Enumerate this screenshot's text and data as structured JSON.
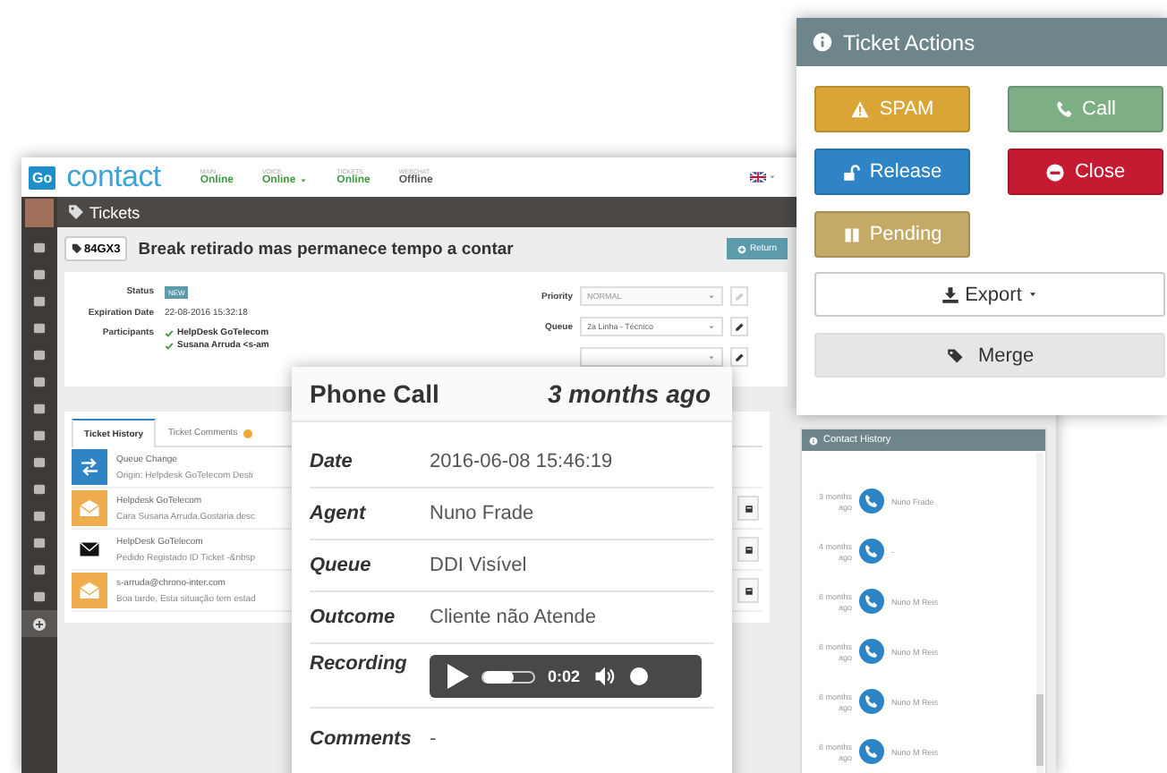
{
  "app": {
    "logo": "Go",
    "brand": "contact",
    "statuses": [
      {
        "label": "MAIN",
        "value": "Online",
        "online": true,
        "dropdown": false
      },
      {
        "label": "VOICE",
        "value": "Online",
        "online": true,
        "dropdown": true
      },
      {
        "label": "TICKETS",
        "value": "Online",
        "online": true,
        "dropdown": false
      },
      {
        "label": "WEBCHAT",
        "value": "Offline",
        "online": false,
        "dropdown": false
      }
    ],
    "section_title": "Tickets",
    "sidebar": {
      "items": [
        {
          "selected": false
        },
        {
          "selected": false
        },
        {
          "selected": false
        },
        {
          "selected": false
        },
        {
          "selected": false
        },
        {
          "selected": false
        },
        {
          "selected": false
        },
        {
          "selected": false
        },
        {
          "selected": false
        },
        {
          "selected": false
        },
        {
          "selected": false
        },
        {
          "selected": false
        },
        {
          "selected": false
        },
        {
          "selected": false
        },
        {
          "selected": true
        }
      ]
    },
    "ticket": {
      "id": "84GX3",
      "title": "Break retirado mas permanece tempo a contar",
      "return_button": "Return",
      "fields": [
        {
          "label": "Status",
          "kind": "badge",
          "value": "NEW"
        },
        {
          "label": "Expiration Date",
          "kind": "text",
          "value": "22-08-2016 15:32:18"
        },
        {
          "label": "Participants",
          "kind": "list",
          "values": [
            "HelpDesk GoTelecom",
            "Susana Arruda <s-am"
          ]
        }
      ],
      "side_fields": [
        {
          "label": "Priority",
          "value": "NORMAL",
          "disabled": true
        },
        {
          "label": "Queue",
          "value": "2a Linha - Técnico",
          "disabled": false
        },
        {
          "disabled": false
        }
      ]
    },
    "tabs": [
      {
        "label": "Ticket History",
        "selected": true,
        "badge": false
      },
      {
        "label": "Ticket Comments",
        "selected": false,
        "badge": true
      }
    ],
    "history": [
      {
        "kind": "queue",
        "title": "Queue Change",
        "text": "Origin: Helpdesk GoTelecom Desti",
        "action": false
      },
      {
        "kind": "email_in",
        "title": "Helpdesk GoTelecom",
        "text": "Cara Susana Arruda,Gostaria desc",
        "action": true
      },
      {
        "kind": "email_out",
        "title": "HelpDesk GoTelecom",
        "text": "Pedido Registado ID Ticket -&nbsp",
        "action": true
      },
      {
        "kind": "email_in",
        "title": "s-arruda@chrono-inter.com",
        "text": "Boa tarde, Esta situação tem estad",
        "action": true
      }
    ],
    "contact_history": {
      "title": "Contact History",
      "rows": [
        {
          "time": "3 months",
          "suffix": "ago",
          "name": "Nuno Frade"
        },
        {
          "time": "4 months",
          "suffix": "ago",
          "name": "-"
        },
        {
          "time": "8 months",
          "suffix": "ago",
          "name": "Nuno M Reis"
        },
        {
          "time": "8 months",
          "suffix": "ago",
          "name": "Nuno M Reis"
        },
        {
          "time": "8 months",
          "suffix": "ago",
          "name": "Nuno M Reis"
        },
        {
          "time": "8 months",
          "suffix": "ago",
          "name": "Nuno M Reis"
        }
      ]
    }
  },
  "phone_call": {
    "title": "Phone Call",
    "when": "3 months ago",
    "details": [
      {
        "label": "Date",
        "kind": "text",
        "value": "2016-06-08 15:46:19"
      },
      {
        "label": "Agent",
        "kind": "text",
        "value": "Nuno Frade"
      },
      {
        "label": "Queue",
        "kind": "text",
        "value": "DDI Visível"
      },
      {
        "label": "Outcome",
        "kind": "text",
        "value": "Cliente não Atende"
      },
      {
        "label": "Recording",
        "kind": "audio",
        "time": "0:02",
        "level": 0.6
      },
      {
        "label": "Comments",
        "kind": "text",
        "value": "-"
      }
    ]
  },
  "ticket_actions": {
    "title": "Ticket Actions",
    "buttons": [
      {
        "label": "SPAM",
        "color": "#d9a537"
      },
      {
        "label": "Call",
        "color": "#7eae84"
      },
      {
        "label": "Release",
        "color": "#2e84c5"
      },
      {
        "label": "Close",
        "color": "#c41a32"
      },
      {
        "label": "Pending",
        "color": "#c4aa66"
      }
    ],
    "export_button": "Export",
    "merge_button": "Merge"
  }
}
